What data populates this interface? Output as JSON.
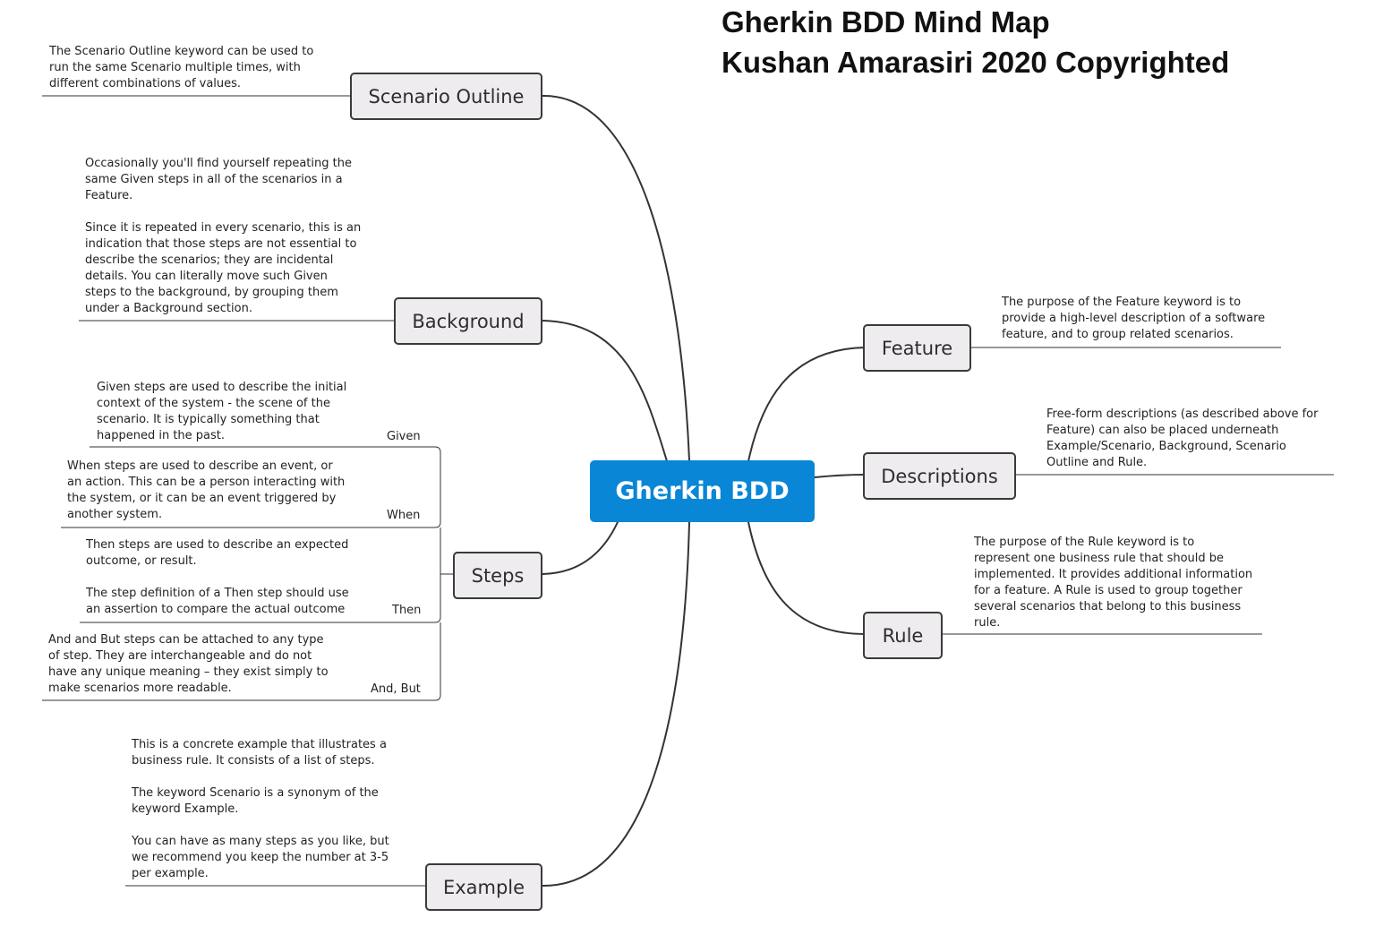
{
  "title": {
    "line1": "Gherkin BDD Mind Map",
    "line2": "Kushan Amarasiri 2020 Copyrighted"
  },
  "central": "Gherkin BDD",
  "topics": {
    "scenario_outline": "Scenario Outline",
    "background": "Background",
    "steps": "Steps",
    "example": "Example",
    "feature": "Feature",
    "descriptions": "Descriptions",
    "rule": "Rule"
  },
  "notes": {
    "scenario_outline": "The Scenario Outline keyword can be used to\nrun the same Scenario multiple times, with\ndifferent combinations of values.",
    "background": "Occasionally you'll find yourself repeating the\nsame Given steps in all of the scenarios in a\nFeature.\n\nSince it is repeated in every scenario, this is an\nindication that those steps are not essential to\ndescribe the scenarios; they are incidental\ndetails. You can literally move such Given\nsteps to the background, by grouping them\nunder a Background section.",
    "example": "This is a concrete example that illustrates a\nbusiness rule. It consists of a list of steps.\n\nThe keyword Scenario is a synonym of the\nkeyword Example.\n\nYou can have as many steps as you like, but\nwe recommend you keep the number at 3-5\nper example.",
    "feature": "The purpose of the Feature keyword is to\nprovide a high-level description of a software\nfeature, and to group related scenarios.",
    "descriptions": "Free-form descriptions (as described above for\nFeature) can also be placed underneath\nExample/Scenario, Background, Scenario\nOutline and Rule.",
    "rule": "The purpose of the Rule keyword is to\nrepresent one business rule that should be\nimplemented. It provides additional information\nfor a feature. A Rule is used to group together\nseveral scenarios that belong to this business\nrule."
  },
  "steps": {
    "given": {
      "label": "Given",
      "note": "Given steps are used to describe the initial\ncontext of the system - the scene of the\nscenario. It is typically something that\nhappened in the past."
    },
    "when": {
      "label": "When",
      "note": "When steps are used to describe an event, or\nan action. This can be a person interacting with\nthe system, or it can be an event triggered by\nanother system."
    },
    "then": {
      "label": "Then",
      "note": "Then steps are used to describe an expected\noutcome, or result.\n\nThe step definition of a Then step should use\nan assertion to compare the actual outcome"
    },
    "and_but": {
      "label": "And, But",
      "note": " And and But steps can be attached to any type\nof step. They are interchangeable and do not\nhave any unique meaning – they exist simply to\nmake scenarios more readable."
    }
  },
  "colors": {
    "central_fill": "#0a86d6",
    "topic_fill": "#eeecee",
    "line": "#3a3a3a"
  }
}
